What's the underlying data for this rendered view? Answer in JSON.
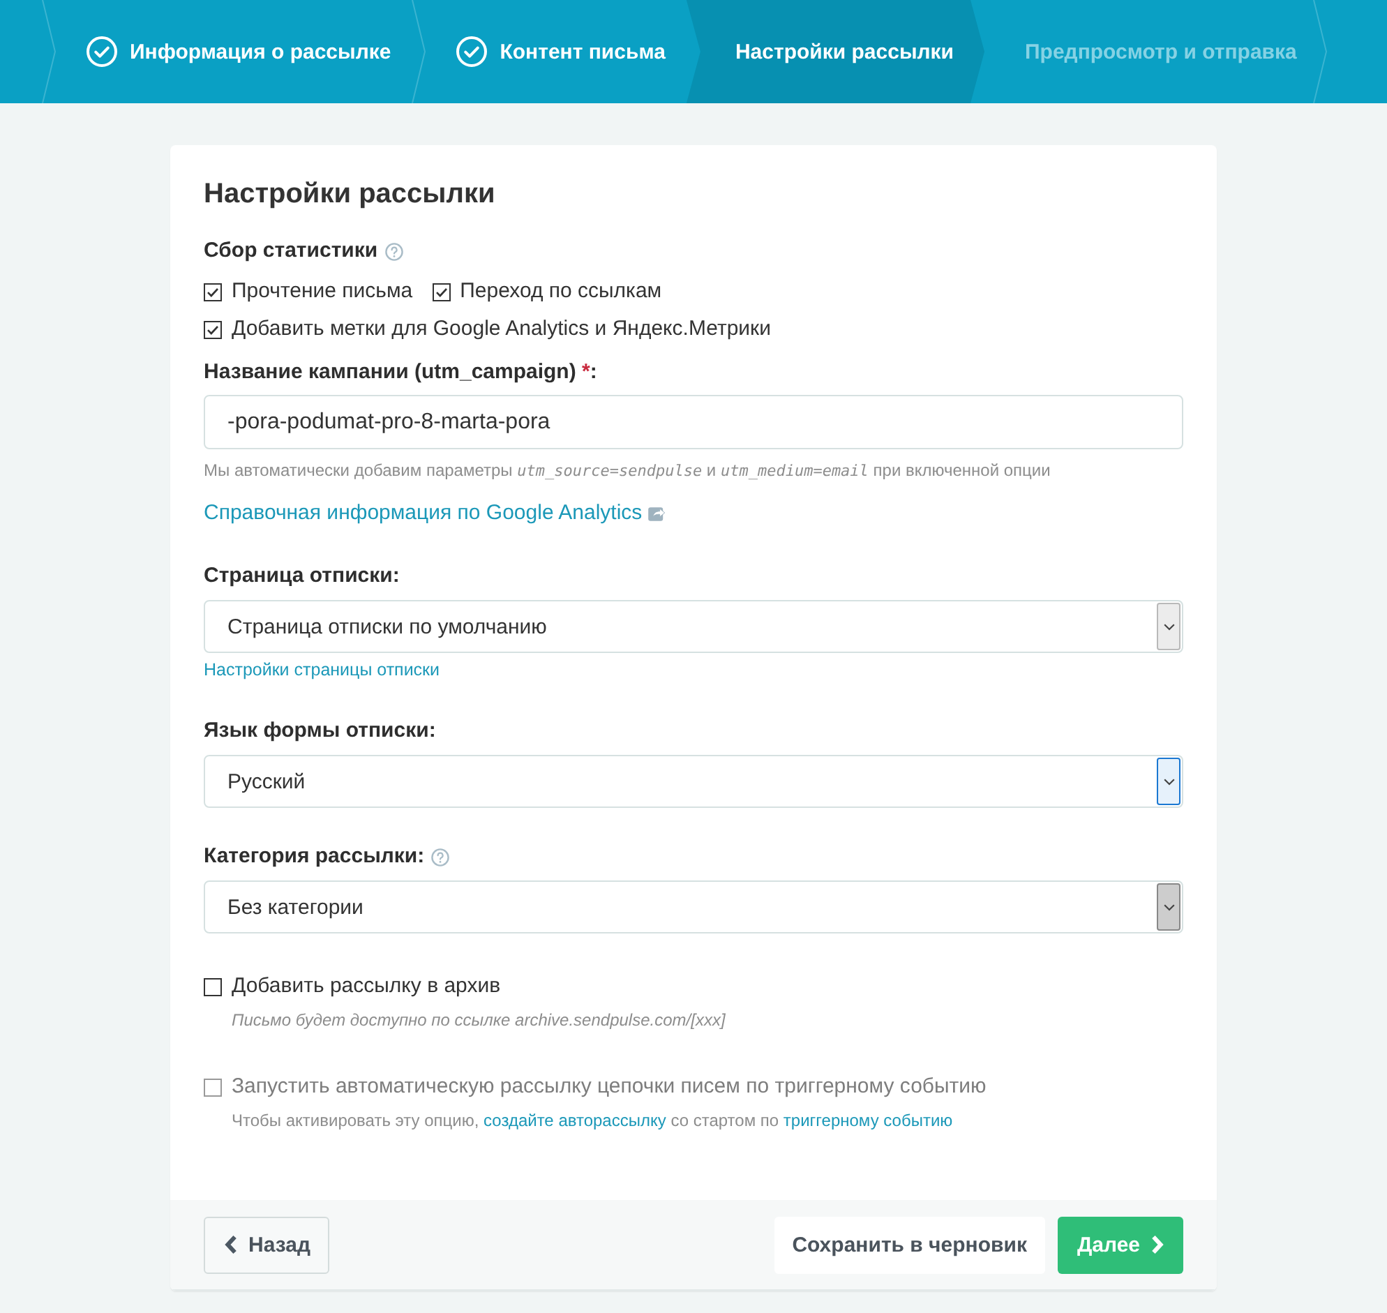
{
  "steps": [
    {
      "label": "Информация о рассылке",
      "completed": true,
      "selected": false
    },
    {
      "label": "Контент письма",
      "completed": true,
      "selected": false
    },
    {
      "label": "Настройки рассылки",
      "completed": false,
      "selected": true
    },
    {
      "label": "Предпросмотр и отправка",
      "completed": false,
      "selected": false
    }
  ],
  "card": {
    "title": "Настройки рассылки"
  },
  "form": [
    {
      "kind": "checkgroup",
      "label": "Сбор статистики",
      "help": true,
      "rows": [
        [
          {
            "label": "Прочтение письма",
            "checked": true
          },
          {
            "label": "Переход по ссылкам",
            "checked": true
          }
        ],
        [
          {
            "label": "Добавить метки для Google Analytics и Яндекс.Метрики",
            "checked": true
          }
        ]
      ]
    },
    {
      "kind": "text",
      "label": "Название кампании (utm_campaign)",
      "required_mark": "*",
      "label_suffix": ":",
      "value": "-pora-podumat-pro-8-marta-pora",
      "hint": "Мы автоматически добавим параметры *utm_source=sendpulse* и *utm_medium=email* при включенной опции",
      "link": {
        "text": "Справочная информация по Google Analytics",
        "external": true
      }
    },
    {
      "kind": "select",
      "label": "Страница отписки:",
      "help": false,
      "value": "Страница отписки по умолчанию",
      "focused": false,
      "hovered": false,
      "link": {
        "text": "Настройки страницы отписки",
        "external": false
      }
    },
    {
      "kind": "select",
      "label": "Язык формы отписки:",
      "help": false,
      "value": "Русский",
      "focused": true,
      "hovered": false
    },
    {
      "kind": "select",
      "label": "Категория рассылки:",
      "help": true,
      "value": "Без категории",
      "focused": false,
      "hovered": true
    },
    {
      "kind": "checkbox",
      "label": "Добавить рассылку в архив",
      "checked": false,
      "disabled": false,
      "hint": {
        "italic": true,
        "parts": [
          {
            "kind": "text",
            "text": "Письмо будет доступно по ссылке archive.sendpulse.com/[xxx]"
          }
        ]
      }
    },
    {
      "kind": "checkbox",
      "label": "Запустить автоматическую рассылку цепочки писем по триггерному событию",
      "checked": false,
      "disabled": true,
      "hint": {
        "italic": false,
        "parts": [
          {
            "kind": "text",
            "text": "Чтобы активировать эту опцию, "
          },
          {
            "kind": "link",
            "text": "создайте авторассылку"
          },
          {
            "kind": "text",
            "text": " со стартом по "
          },
          {
            "kind": "link",
            "text": "триггерному событию"
          }
        ]
      }
    }
  ],
  "footer": {
    "buttons": [
      {
        "kind": "back",
        "label": "Назад"
      },
      {
        "kind": "secondary",
        "label": "Сохранить в черновик"
      },
      {
        "kind": "primary",
        "label": "Далее"
      }
    ]
  }
}
